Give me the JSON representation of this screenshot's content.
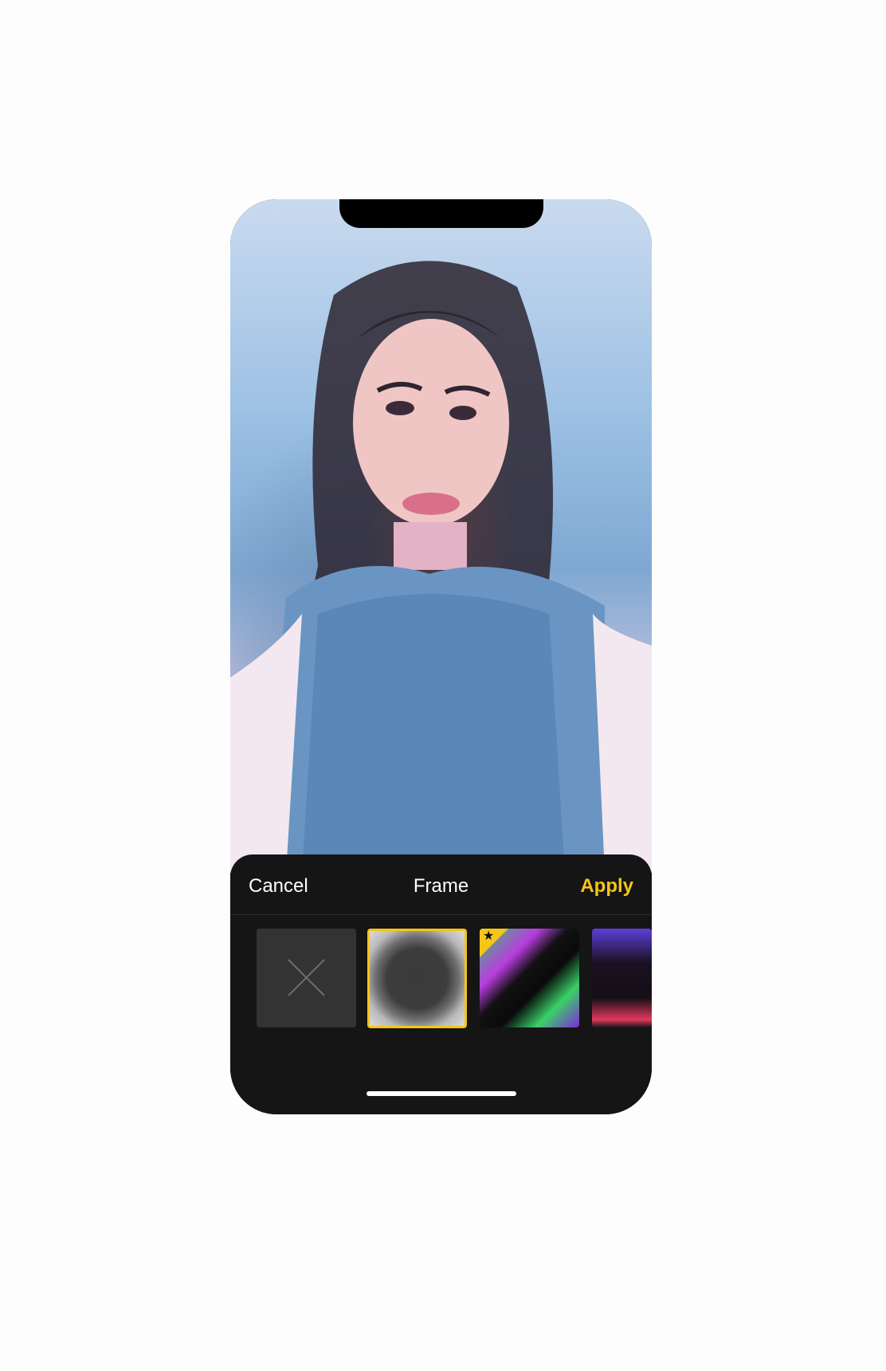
{
  "sheet": {
    "cancel_label": "Cancel",
    "title": "Frame",
    "apply_label": "Apply"
  },
  "frames": [
    {
      "name": "none",
      "selected": false,
      "premium": false
    },
    {
      "name": "grunge-white",
      "selected": true,
      "premium": false
    },
    {
      "name": "neon-paint",
      "selected": false,
      "premium": true
    },
    {
      "name": "purple-red",
      "selected": false,
      "premium": false
    }
  ],
  "colors": {
    "accent": "#f5c518",
    "sheet_background": "#151515",
    "page_background": "#fdfdfd"
  },
  "icons": {
    "none_frame": "x-icon",
    "premium_badge": "star-icon"
  }
}
